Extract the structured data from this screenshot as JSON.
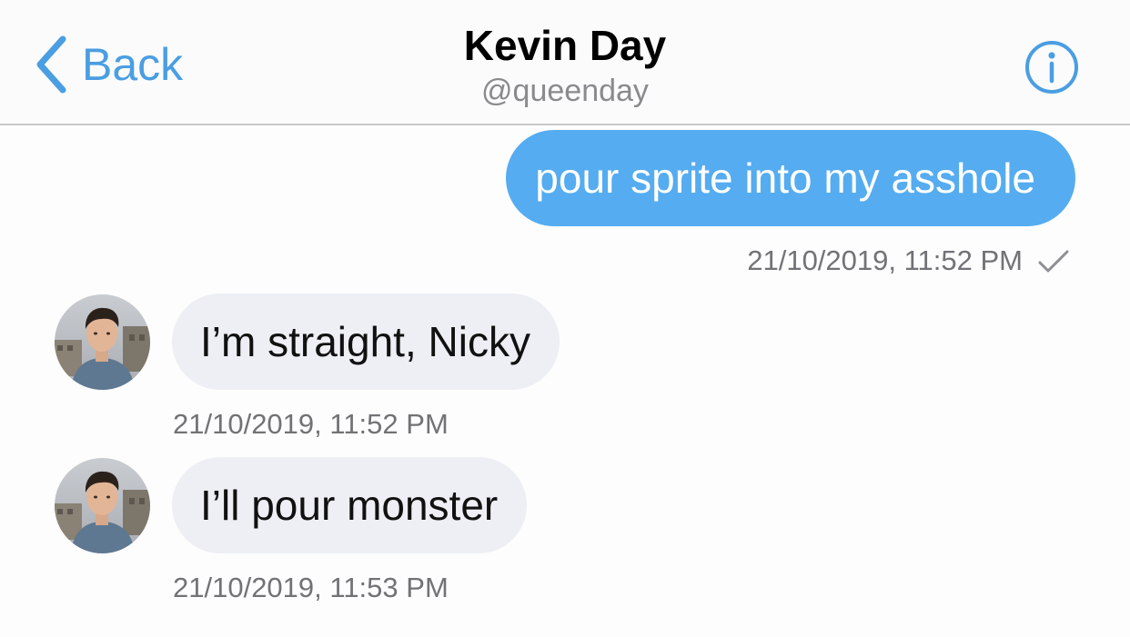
{
  "header": {
    "back_label": "Back",
    "title": "Kevin Day",
    "subtitle": "@queenday",
    "info_icon": "info-icon",
    "back_icon": "chevron-left-icon"
  },
  "messages": [
    {
      "direction": "outgoing",
      "text": "pour sprite into my asshole",
      "timestamp": "21/10/2019, 11:52 PM",
      "status_icon": "checkmark-icon"
    },
    {
      "direction": "incoming",
      "text": "I’m straight, Nicky",
      "timestamp": "21/10/2019, 11:52 PM"
    },
    {
      "direction": "incoming",
      "text": "I’ll pour monster",
      "timestamp": "21/10/2019, 11:53 PM"
    }
  ],
  "colors": {
    "accent": "#4a9ee2",
    "outgoing_bubble": "#55acf0",
    "incoming_bubble": "#eeeff4",
    "timestamp": "#727276"
  }
}
